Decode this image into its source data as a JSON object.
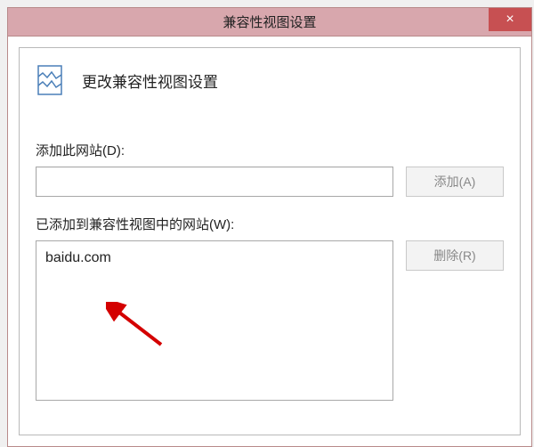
{
  "titlebar": {
    "title": "兼容性视图设置",
    "close_icon": "×"
  },
  "header": {
    "text": "更改兼容性视图设置"
  },
  "add_section": {
    "label": "添加此网站(D):",
    "input_value": "",
    "button_label": "添加(A)"
  },
  "list_section": {
    "label": "已添加到兼容性视图中的网站(W):",
    "items": [
      "baidu.com"
    ],
    "remove_label": "删除(R)"
  }
}
